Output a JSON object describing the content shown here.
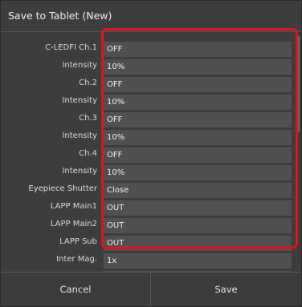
{
  "dialog": {
    "title": "Save to Tablet (New)",
    "highlight_color": "#e0141e"
  },
  "rows": [
    {
      "label": "C-LEDFI Ch.1",
      "value": "OFF"
    },
    {
      "label": "Intensity",
      "value": "10%"
    },
    {
      "label": "Ch.2",
      "value": "OFF"
    },
    {
      "label": "Intensity",
      "value": "10%"
    },
    {
      "label": "Ch.3",
      "value": "OFF"
    },
    {
      "label": "Intensity",
      "value": "10%"
    },
    {
      "label": "Ch.4",
      "value": "OFF"
    },
    {
      "label": "Intensity",
      "value": "10%"
    },
    {
      "label": "Eyepiece Shutter",
      "value": "Close"
    },
    {
      "label": "LAPP Main1",
      "value": "OUT"
    },
    {
      "label": "LAPP Main2",
      "value": "OUT"
    },
    {
      "label": "LAPP Sub",
      "value": "OUT"
    },
    {
      "label": "Inter Mag.",
      "value": "1x"
    },
    {
      "label": "",
      "value": ""
    }
  ],
  "footer": {
    "cancel_label": "Cancel",
    "save_label": "Save"
  }
}
